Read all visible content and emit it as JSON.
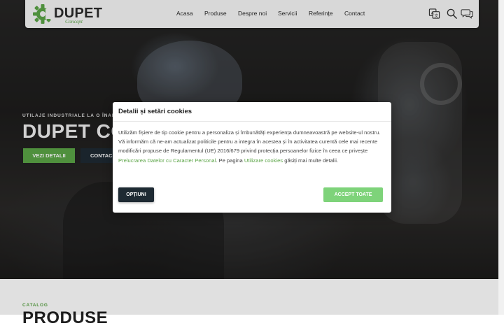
{
  "brand": {
    "name": "DUPET",
    "tagline": "Concept",
    "accent_color": "#5ba446",
    "logo_icon": "gear-logo-icon"
  },
  "nav": {
    "items": [
      "Acasa",
      "Produse",
      "Despre noi",
      "Servicii",
      "Referințe",
      "Contact"
    ],
    "icons": [
      "translate-icon",
      "search-icon",
      "chat-icon"
    ]
  },
  "hero": {
    "subtitle": "UTILAJE INDUSTRIALE LA O ÎNALTĂ CA",
    "title": "DUPET CO",
    "details_button": "VEZI DETALII",
    "contact_button": "CONTAC"
  },
  "catalog": {
    "label": "CATALOG",
    "title": "PRODUSE"
  },
  "cookie_modal": {
    "title": "Detalii și setări cookies",
    "text_1": "Utilizăm fișiere de tip cookie pentru a personaliza și îmbunătăți experiența dumneavoastră pe website-ul nostru. Vă informăm că ne-am actualizat politicile pentru a integra în acestea și în activitatea curentă cele mai recente modificări propuse de Regulamentul (UE) 2016/679 privind protecția persoanelor fizice în ceea ce privește ",
    "link_1": "Prelucrarea Datelor cu Caracter Personal",
    "text_2": ". Pe pagina ",
    "link_2": "Utilizare cookies",
    "text_3": " găsiți mai multe detalii.",
    "options_button": "OPȚIUNI",
    "accept_button": "ACCEPT TOATE",
    "accept_color": "#7ed37a",
    "options_color": "#1e2a33"
  }
}
